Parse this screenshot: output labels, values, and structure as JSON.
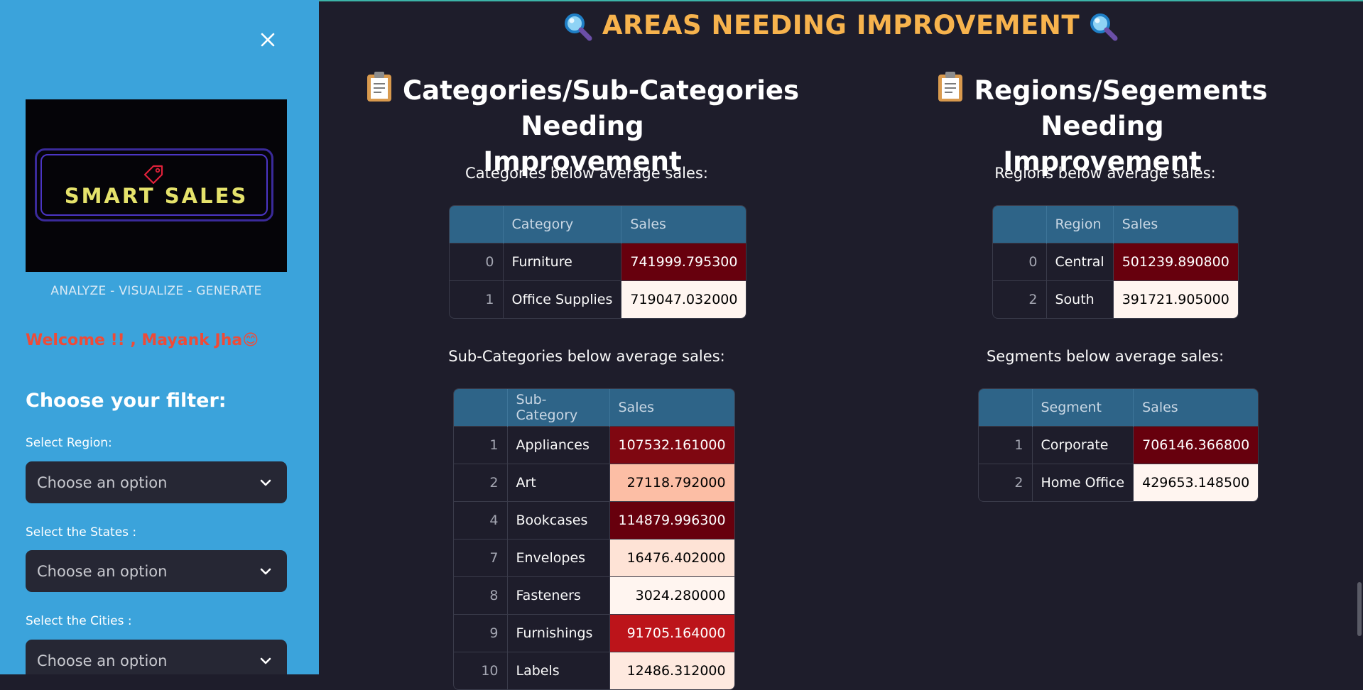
{
  "sidebar": {
    "tagline": "ANALYZE - VISUALIZE - GENERATE",
    "welcome": "Welcome !! , Mayank Jha😊",
    "filter_title": "Choose your filter:",
    "logo": {
      "text": "SMART SALES"
    },
    "region": {
      "label": "Select Region:",
      "placeholder": "Choose an option"
    },
    "states": {
      "label": "Select the States :",
      "placeholder": "Choose an option"
    },
    "cities": {
      "label": "Select the Cities :",
      "placeholder": "Choose an option"
    }
  },
  "main": {
    "title": "AREAS NEEDING IMPROVEMENT",
    "left": {
      "heading_line1": "Categories/Sub-Categories Needing",
      "heading_line2": "Improvement",
      "categories": {
        "caption": "Categories below average sales:",
        "columns": [
          "",
          "Category",
          "Sales"
        ],
        "rows": [
          {
            "idx": "0",
            "name": "Furniture",
            "sales": "741999.795300",
            "bg": "#67000d",
            "fg": "#ffffff"
          },
          {
            "idx": "1",
            "name": "Office Supplies",
            "sales": "719047.032000",
            "bg": "#fff5f0",
            "fg": "#000000"
          }
        ]
      },
      "subcategories": {
        "caption": "Sub-Categories below average sales:",
        "columns": [
          "",
          "Sub-Category",
          "Sales"
        ],
        "rows": [
          {
            "idx": "1",
            "name": "Appliances",
            "sales": "107532.161000",
            "bg": "#7f0711",
            "fg": "#ffffff"
          },
          {
            "idx": "2",
            "name": "Art",
            "sales": "27118.792000",
            "bg": "#fcbea5",
            "fg": "#000000"
          },
          {
            "idx": "4",
            "name": "Bookcases",
            "sales": "114879.996300",
            "bg": "#67000d",
            "fg": "#ffffff"
          },
          {
            "idx": "7",
            "name": "Envelopes",
            "sales": "16476.402000",
            "bg": "#fee3d6",
            "fg": "#000000"
          },
          {
            "idx": "8",
            "name": "Fasteners",
            "sales": "3024.280000",
            "bg": "#fff5f0",
            "fg": "#000000"
          },
          {
            "idx": "9",
            "name": "Furnishings",
            "sales": "91705.164000",
            "bg": "#bc141a",
            "fg": "#ffffff"
          },
          {
            "idx": "10",
            "name": "Labels",
            "sales": "12486.312000",
            "bg": "#fee9df",
            "fg": "#000000"
          }
        ]
      }
    },
    "right": {
      "heading_line1": "Regions/Segements Needing",
      "heading_line2": "Improvement",
      "regions": {
        "caption": "Regions below average sales:",
        "columns": [
          "",
          "Region",
          "Sales"
        ],
        "rows": [
          {
            "idx": "0",
            "name": "Central",
            "sales": "501239.890800",
            "bg": "#67000d",
            "fg": "#ffffff"
          },
          {
            "idx": "2",
            "name": "South",
            "sales": "391721.905000",
            "bg": "#fff5f0",
            "fg": "#000000"
          }
        ]
      },
      "segments": {
        "caption": "Segments below average sales:",
        "columns": [
          "",
          "Segment",
          "Sales"
        ],
        "rows": [
          {
            "idx": "1",
            "name": "Corporate",
            "sales": "706146.366800",
            "bg": "#67000d",
            "fg": "#ffffff"
          },
          {
            "idx": "2",
            "name": "Home Office",
            "sales": "429653.148500",
            "bg": "#fff5f0",
            "fg": "#000000"
          }
        ]
      }
    }
  },
  "colors": {
    "sidebar_bg": "#3ba3db",
    "main_bg": "#1e1d2b",
    "title_color": "#f7b34d",
    "welcome_color": "#ee4b38",
    "table_header_bg": "#2e6488"
  },
  "icons": {
    "close": "close-icon",
    "title": "magnifying-glass-icon",
    "heading": "clipboard-icon",
    "select": "chevron-down-icon"
  }
}
